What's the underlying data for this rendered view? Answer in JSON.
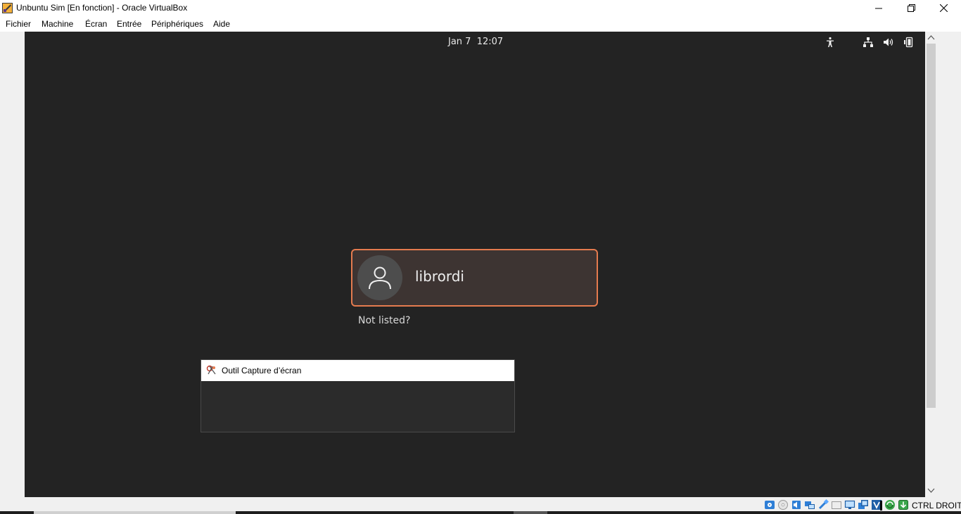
{
  "window": {
    "title": "Unbuntu Sim [En fonction] - Oracle VirtualBox",
    "app_icon": "virtualbox-icon",
    "controls": {
      "minimize": "minimize-icon",
      "maximize": "restore-icon",
      "close": "close-icon"
    }
  },
  "menubar": {
    "items": [
      "Fichier",
      "Machine",
      "Écran",
      "Entrée",
      "Périphériques",
      "Aide"
    ]
  },
  "guest": {
    "topbar": {
      "date": "Jan 7",
      "time": "12:07",
      "tray_icons": [
        "accessibility-icon",
        "network-icon",
        "volume-icon",
        "battery-icon"
      ]
    },
    "login": {
      "user_name": "librordi",
      "avatar_icon": "user-avatar-icon",
      "not_listed": "Not listed?",
      "accent_color": "#e57b4f"
    }
  },
  "snipping_tool": {
    "title": "Outil Capture d’écran",
    "icon": "scissors-icon"
  },
  "statusbar": {
    "icons": [
      "hard-disk-icon",
      "optical-drive-icon",
      "audio-icon",
      "network-adapter-icon",
      "usb-icon",
      "shared-folders-icon",
      "display-icon",
      "recording-icon",
      "vm-icon",
      "mouse-integration-icon",
      "cpu-icon",
      "keyboard-icon"
    ],
    "host_key": "CTRL DROITE"
  }
}
